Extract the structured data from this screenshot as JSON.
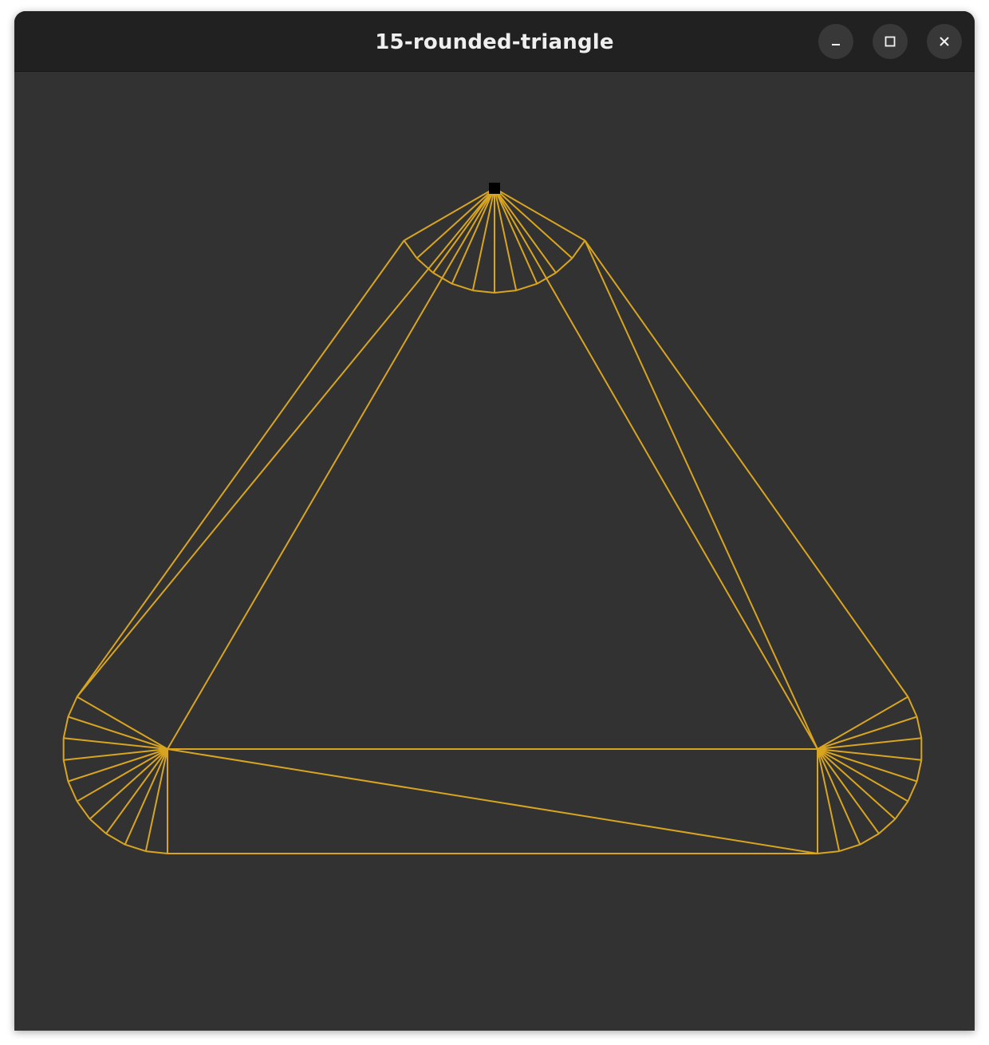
{
  "window": {
    "title": "15-rounded-triangle"
  },
  "titlebar_buttons": {
    "minimize": "minimize-icon",
    "maximize": "maximize-icon",
    "close": "close-icon"
  },
  "scene": {
    "background_color": "#323232",
    "wireframe_color": "#d9a521",
    "marker_color": "#000000",
    "render_mode": "wireframe",
    "segments_per_corner": 10
  }
}
